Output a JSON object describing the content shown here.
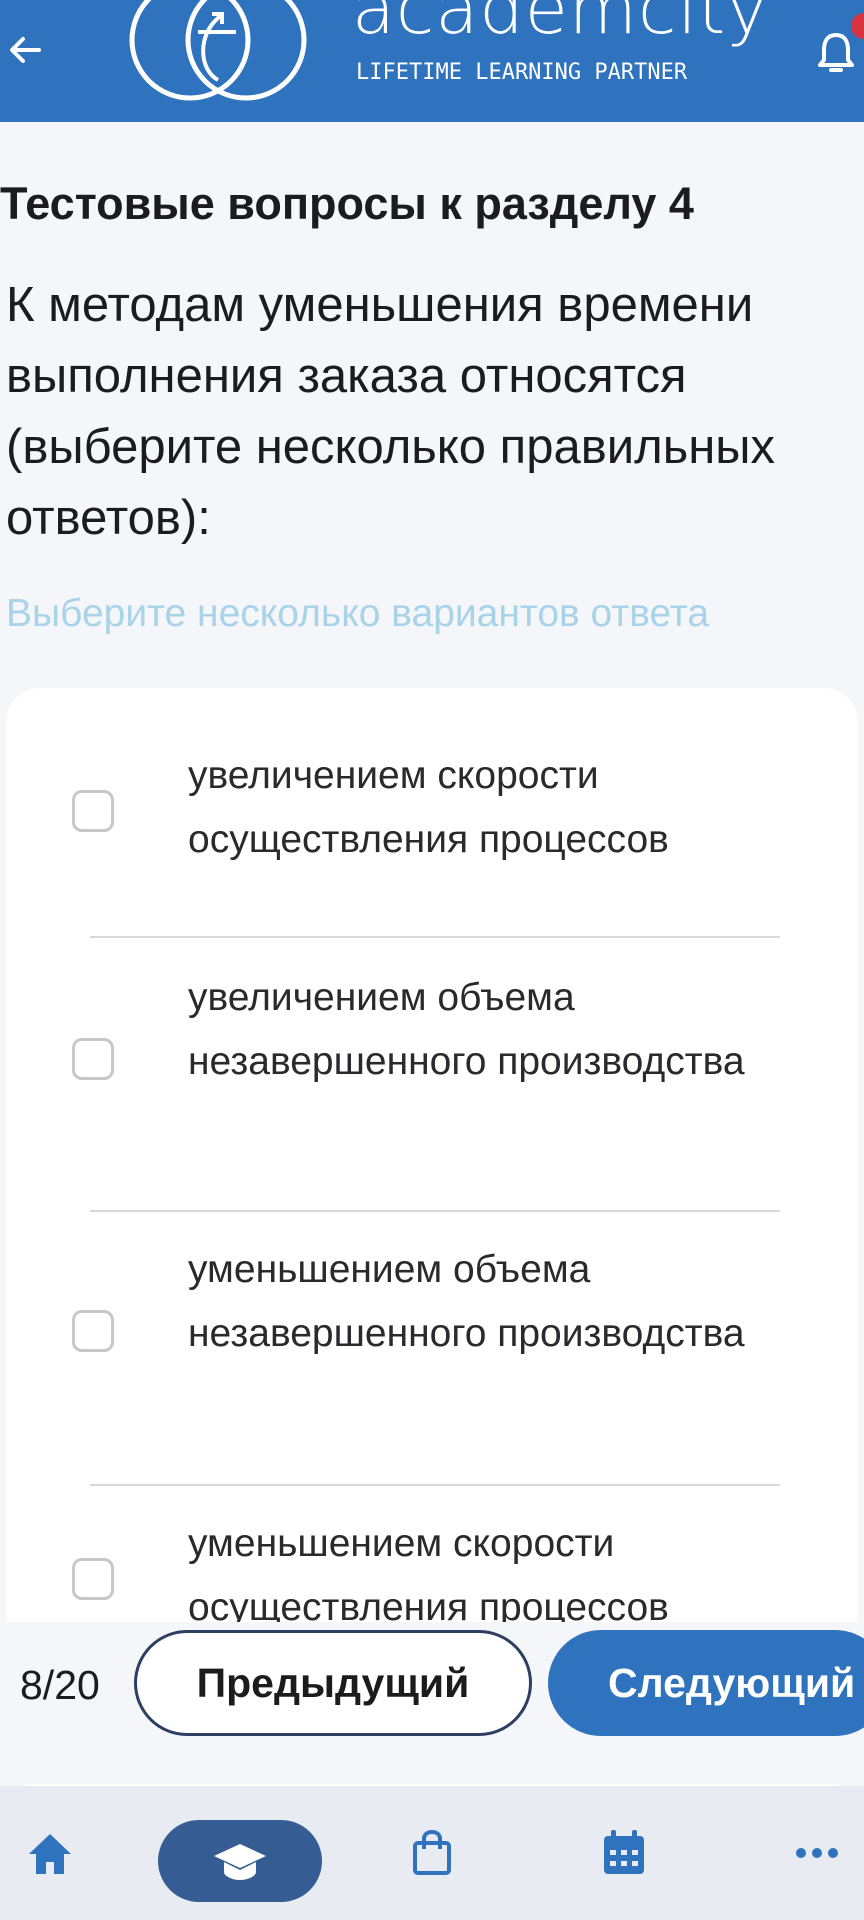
{
  "header": {
    "brand": "academcity",
    "tagline": "LIFETIME LEARNING PARTNER"
  },
  "quiz": {
    "section_title": "Тестовые вопросы к разделу 4",
    "question": "К методам уменьшения времени выполнения заказа относятся (выберите несколько правильных ответов):",
    "hint": "Выберите несколько вариантов ответа",
    "options": [
      {
        "label": "увеличением скорости осуществления процессов",
        "checked": false
      },
      {
        "label": "увеличением объема незавершенного производства",
        "checked": false
      },
      {
        "label": "уменьшением объема незавершенного производства",
        "checked": false
      },
      {
        "label": "уменьшением скорости осуществления процессов",
        "checked": false
      }
    ]
  },
  "navigation": {
    "counter": "8/20",
    "prev_label": "Предыдущий",
    "next_label": "Следующий"
  },
  "tabs": [
    {
      "icon": "home-icon",
      "active": false
    },
    {
      "icon": "graduation-cap-icon",
      "active": true
    },
    {
      "icon": "shopping-bag-icon",
      "active": false
    },
    {
      "icon": "calendar-icon",
      "active": false
    },
    {
      "icon": "more-icon",
      "active": false
    }
  ],
  "colors": {
    "primary": "#2f72bd",
    "hint": "#a8d3e8",
    "tab_active": "#355d93",
    "badge": "#d8313f"
  }
}
